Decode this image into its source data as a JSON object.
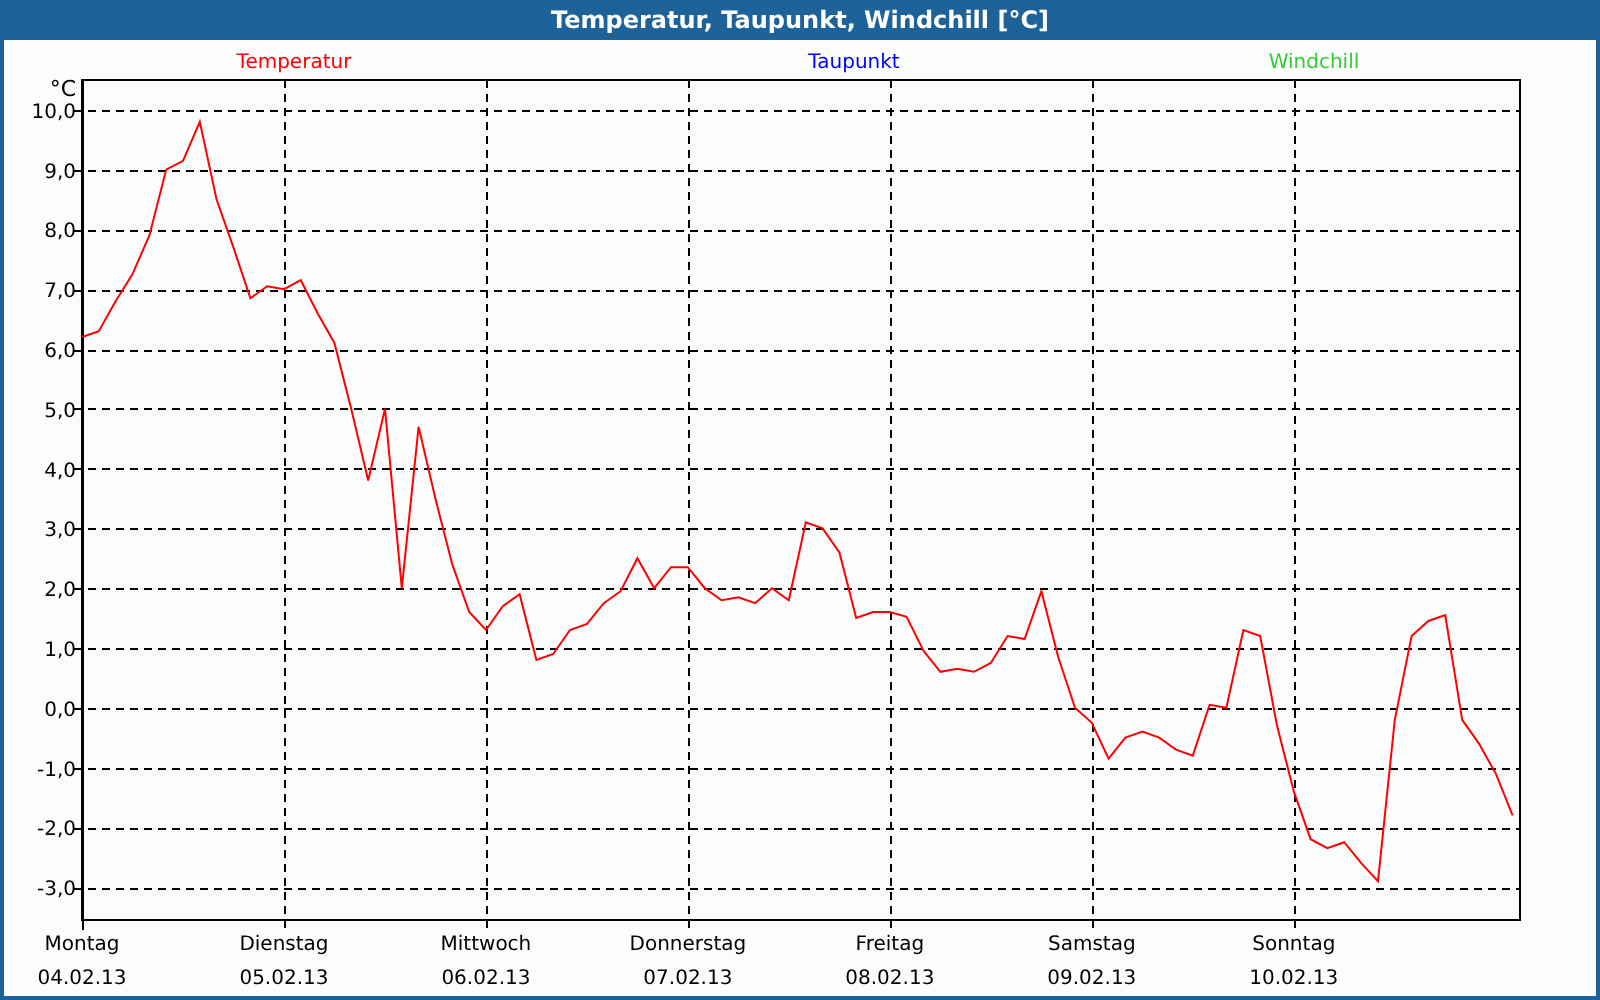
{
  "window": {
    "title": "Temperatur, Taupunkt, Windchill [°C]"
  },
  "legend": [
    {
      "label": "Taupunkt",
      "color": "#0000ff"
    },
    {
      "label": "Windchill",
      "color": "#33cc33"
    }
  ],
  "chart": {
    "unit": "°C",
    "dates": [
      "04.02.13",
      "05.02.13",
      "06.02.13",
      "07.02.13",
      "08.02.13",
      "09.02.13",
      "10.02.13"
    ],
    "chart_data": {
      "type": "line",
      "grid": true,
      "ylim": [
        -3.55,
        10.5
      ],
      "yticks": [
        {
          "value": 10,
          "label": "10,0"
        },
        {
          "value": 9,
          "label": "9,0"
        },
        {
          "value": 8,
          "label": "8,0"
        },
        {
          "value": 7,
          "label": "7,0"
        },
        {
          "value": 6,
          "label": "6,0"
        },
        {
          "value": 5,
          "label": "5,0"
        },
        {
          "value": 4,
          "label": "4,0"
        },
        {
          "value": 3,
          "label": "3,0"
        },
        {
          "value": 2,
          "label": "2,0"
        },
        {
          "value": 1,
          "label": "1,0"
        },
        {
          "value": 0,
          "label": "0,0"
        },
        {
          "value": -1,
          "label": "-1,0"
        },
        {
          "value": -2,
          "label": "-2,0"
        },
        {
          "value": -3,
          "label": "-3,0"
        }
      ],
      "categories": [
        "Montag",
        null,
        null,
        null,
        null,
        null,
        null,
        null,
        null,
        null,
        null,
        null,
        "Dienstag",
        null,
        null,
        null,
        null,
        null,
        null,
        null,
        null,
        null,
        null,
        null,
        "Mittwoch",
        null,
        null,
        null,
        null,
        null,
        null,
        null,
        null,
        null,
        null,
        null,
        "Donnerstag",
        null,
        null,
        null,
        null,
        null,
        null,
        null,
        null,
        null,
        null,
        null,
        "Freitag",
        null,
        null,
        null,
        null,
        null,
        null,
        null,
        null,
        null,
        null,
        null,
        "Samstag",
        null,
        null,
        null,
        null,
        null,
        null,
        null,
        null,
        null,
        null,
        null,
        "Sonntag",
        null,
        null,
        null,
        null,
        null,
        null,
        null,
        null,
        null,
        null,
        null,
        null,
        null
      ],
      "series": [
        {
          "name": "Temperatur",
          "color": "#ff0000",
          "values": [
            6.2,
            6.3,
            6.8,
            7.25,
            7.9,
            9.0,
            9.15,
            9.8,
            8.5,
            7.7,
            6.85,
            7.05,
            7.0,
            7.15,
            6.6,
            6.1,
            5.0,
            3.8,
            5.0,
            2.0,
            4.7,
            3.5,
            2.4,
            1.6,
            1.3,
            1.7,
            1.9,
            0.8,
            0.9,
            1.3,
            1.4,
            1.75,
            1.95,
            2.5,
            2.0,
            2.35,
            2.35,
            2.0,
            1.8,
            1.85,
            1.75,
            2.0,
            1.8,
            3.1,
            3.0,
            2.6,
            1.5,
            1.6,
            1.6,
            1.52,
            0.95,
            0.6,
            0.65,
            0.6,
            0.75,
            1.2,
            1.15,
            1.95,
            0.85,
            0.0,
            -0.25,
            -0.85,
            -0.5,
            -0.4,
            -0.5,
            -0.7,
            -0.8,
            0.05,
            0.0,
            1.3,
            1.2,
            -0.3,
            -1.4,
            -2.2,
            -2.35,
            -2.25,
            -2.6,
            -2.9,
            -0.2,
            1.2,
            1.45,
            1.55,
            -0.2,
            -0.6,
            -1.1,
            -1.8
          ]
        }
      ]
    }
  }
}
